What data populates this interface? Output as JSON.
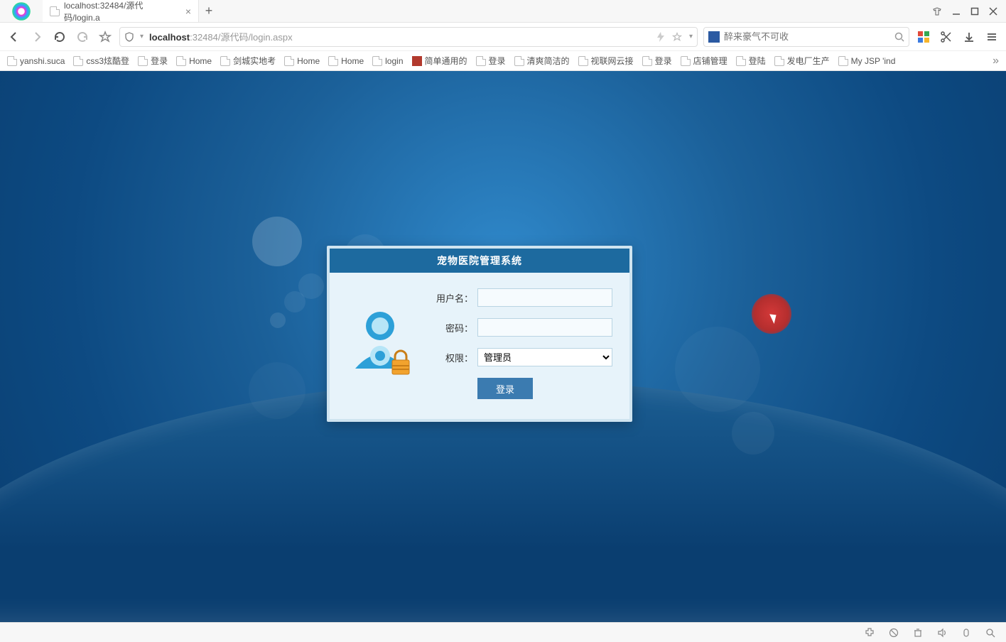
{
  "tab": {
    "title": "localhost:32484/源代码/login.a"
  },
  "address": {
    "host": "localhost",
    "port": ":32484",
    "path": "/源代码/login.aspx"
  },
  "search": {
    "placeholder": "醉来豪气不可收"
  },
  "bookmarks": [
    "yanshi.suca",
    "css3炫酷登",
    "登录",
    "Home",
    "剑城实地考",
    "Home",
    "Home",
    "login",
    "简单通用的",
    "登录",
    "清爽简洁的",
    "视联网云接",
    "登录",
    "店铺管理",
    "登陆",
    "发电厂生产",
    "My JSP 'ind"
  ],
  "login": {
    "title": "宠物医院管理系统",
    "username_label": "用户名：",
    "password_label": "密码：",
    "role_label": "权限：",
    "role_value": "管理员",
    "submit": "登录"
  },
  "colors": {
    "header": "#1d6a9f",
    "button": "#3b7bb0",
    "bg_dark": "#0a3e70"
  }
}
